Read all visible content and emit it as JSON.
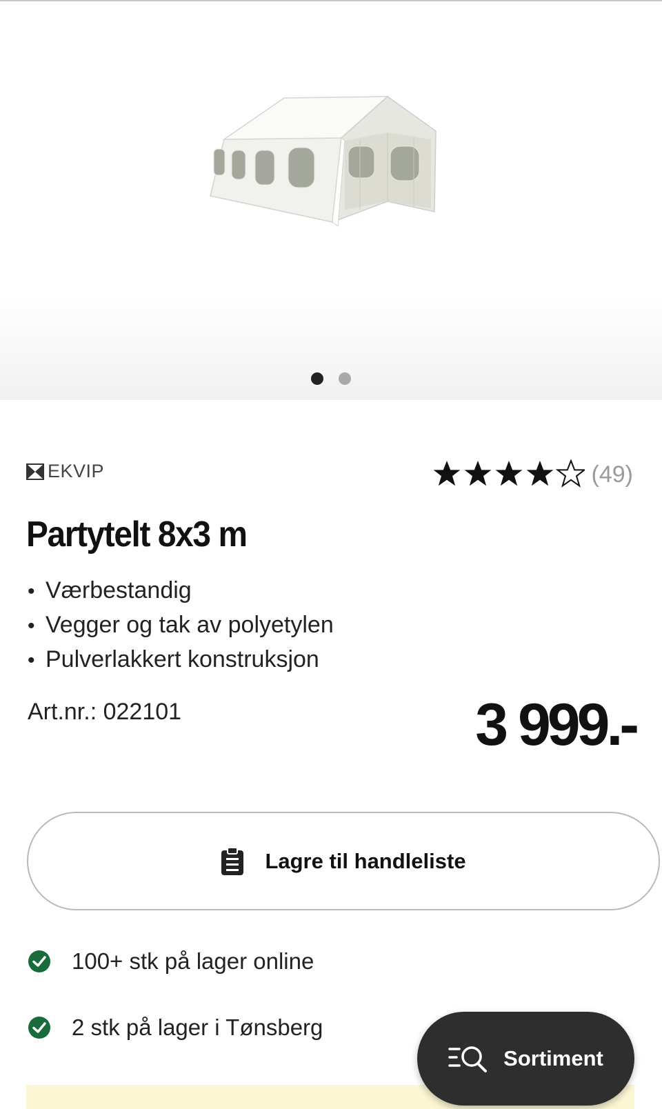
{
  "gallery": {
    "slides": 2,
    "active_slide": 1
  },
  "product": {
    "brand": "EKVIP",
    "rating": 4.5,
    "review_count": "(49)",
    "title": "Partytelt 8x3 m",
    "features": [
      "Værbestandig",
      "Vegger og tak av polyetylen",
      "Pulverlakkert konstruksjon"
    ],
    "article_number": "Art.nr.: 022101",
    "price": "3 999.-"
  },
  "actions": {
    "save_to_list": "Lagre til handleliste"
  },
  "stock": [
    {
      "text": "100+ stk på lager online",
      "status_color": "#1a6b3c"
    },
    {
      "text": "2 stk på lager i Tønsberg",
      "status_color": "#1a6b3c"
    }
  ],
  "floating": {
    "sortiment": "Sortiment"
  },
  "colors": {
    "promo_bg": "#fbf6d3",
    "fab_bg": "#2e2e2e"
  }
}
